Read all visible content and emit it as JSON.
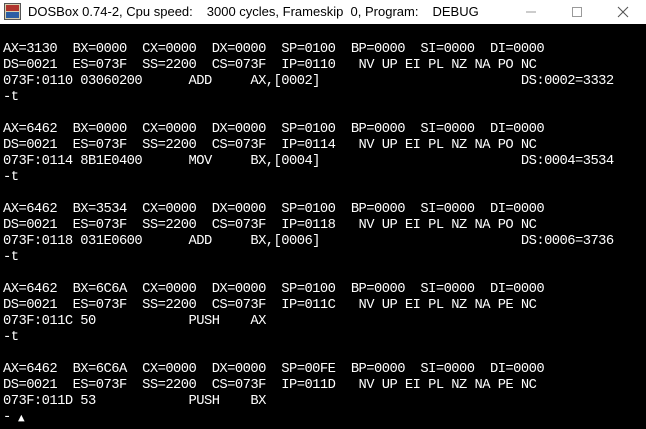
{
  "window": {
    "title_app": "DOSBox 0.74-2, Cpu speed:",
    "title_speed": "3000 cycles, Frameskip  0, Program:",
    "title_program": "DEBUG",
    "minimize_glyph": "—",
    "maximize_glyph": "☐",
    "close_glyph": "✕"
  },
  "console": {
    "lines": [
      "AX=3130  BX=0000  CX=0000  DX=0000  SP=0100  BP=0000  SI=0000  DI=0000",
      "DS=0021  ES=073F  SS=2200  CS=073F  IP=0110   NV UP EI PL NZ NA PO NC",
      "073F:0110 03060200      ADD     AX,[0002]                          DS:0002=3332",
      "-t",
      "",
      "AX=6462  BX=0000  CX=0000  DX=0000  SP=0100  BP=0000  SI=0000  DI=0000",
      "DS=0021  ES=073F  SS=2200  CS=073F  IP=0114   NV UP EI PL NZ NA PO NC",
      "073F:0114 8B1E0400      MOV     BX,[0004]                          DS:0004=3534",
      "-t",
      "",
      "AX=6462  BX=3534  CX=0000  DX=0000  SP=0100  BP=0000  SI=0000  DI=0000",
      "DS=0021  ES=073F  SS=2200  CS=073F  IP=0118   NV UP EI PL NZ NA PO NC",
      "073F:0118 031E0600      ADD     BX,[0006]                          DS:0006=3736",
      "-t",
      "",
      "AX=6462  BX=6C6A  CX=0000  DX=0000  SP=0100  BP=0000  SI=0000  DI=0000",
      "DS=0021  ES=073F  SS=2200  CS=073F  IP=011C   NV UP EI PL NZ NA PE NC",
      "073F:011C 50            PUSH    AX",
      "-t",
      "",
      "AX=6462  BX=6C6A  CX=0000  DX=0000  SP=00FE  BP=0000  SI=0000  DI=0000",
      "DS=0021  ES=073F  SS=2200  CS=073F  IP=011D   NV UP EI PL NZ NA PE NC",
      "073F:011D 53            PUSH    BX",
      "-"
    ],
    "cursor_glyph": "▲"
  }
}
